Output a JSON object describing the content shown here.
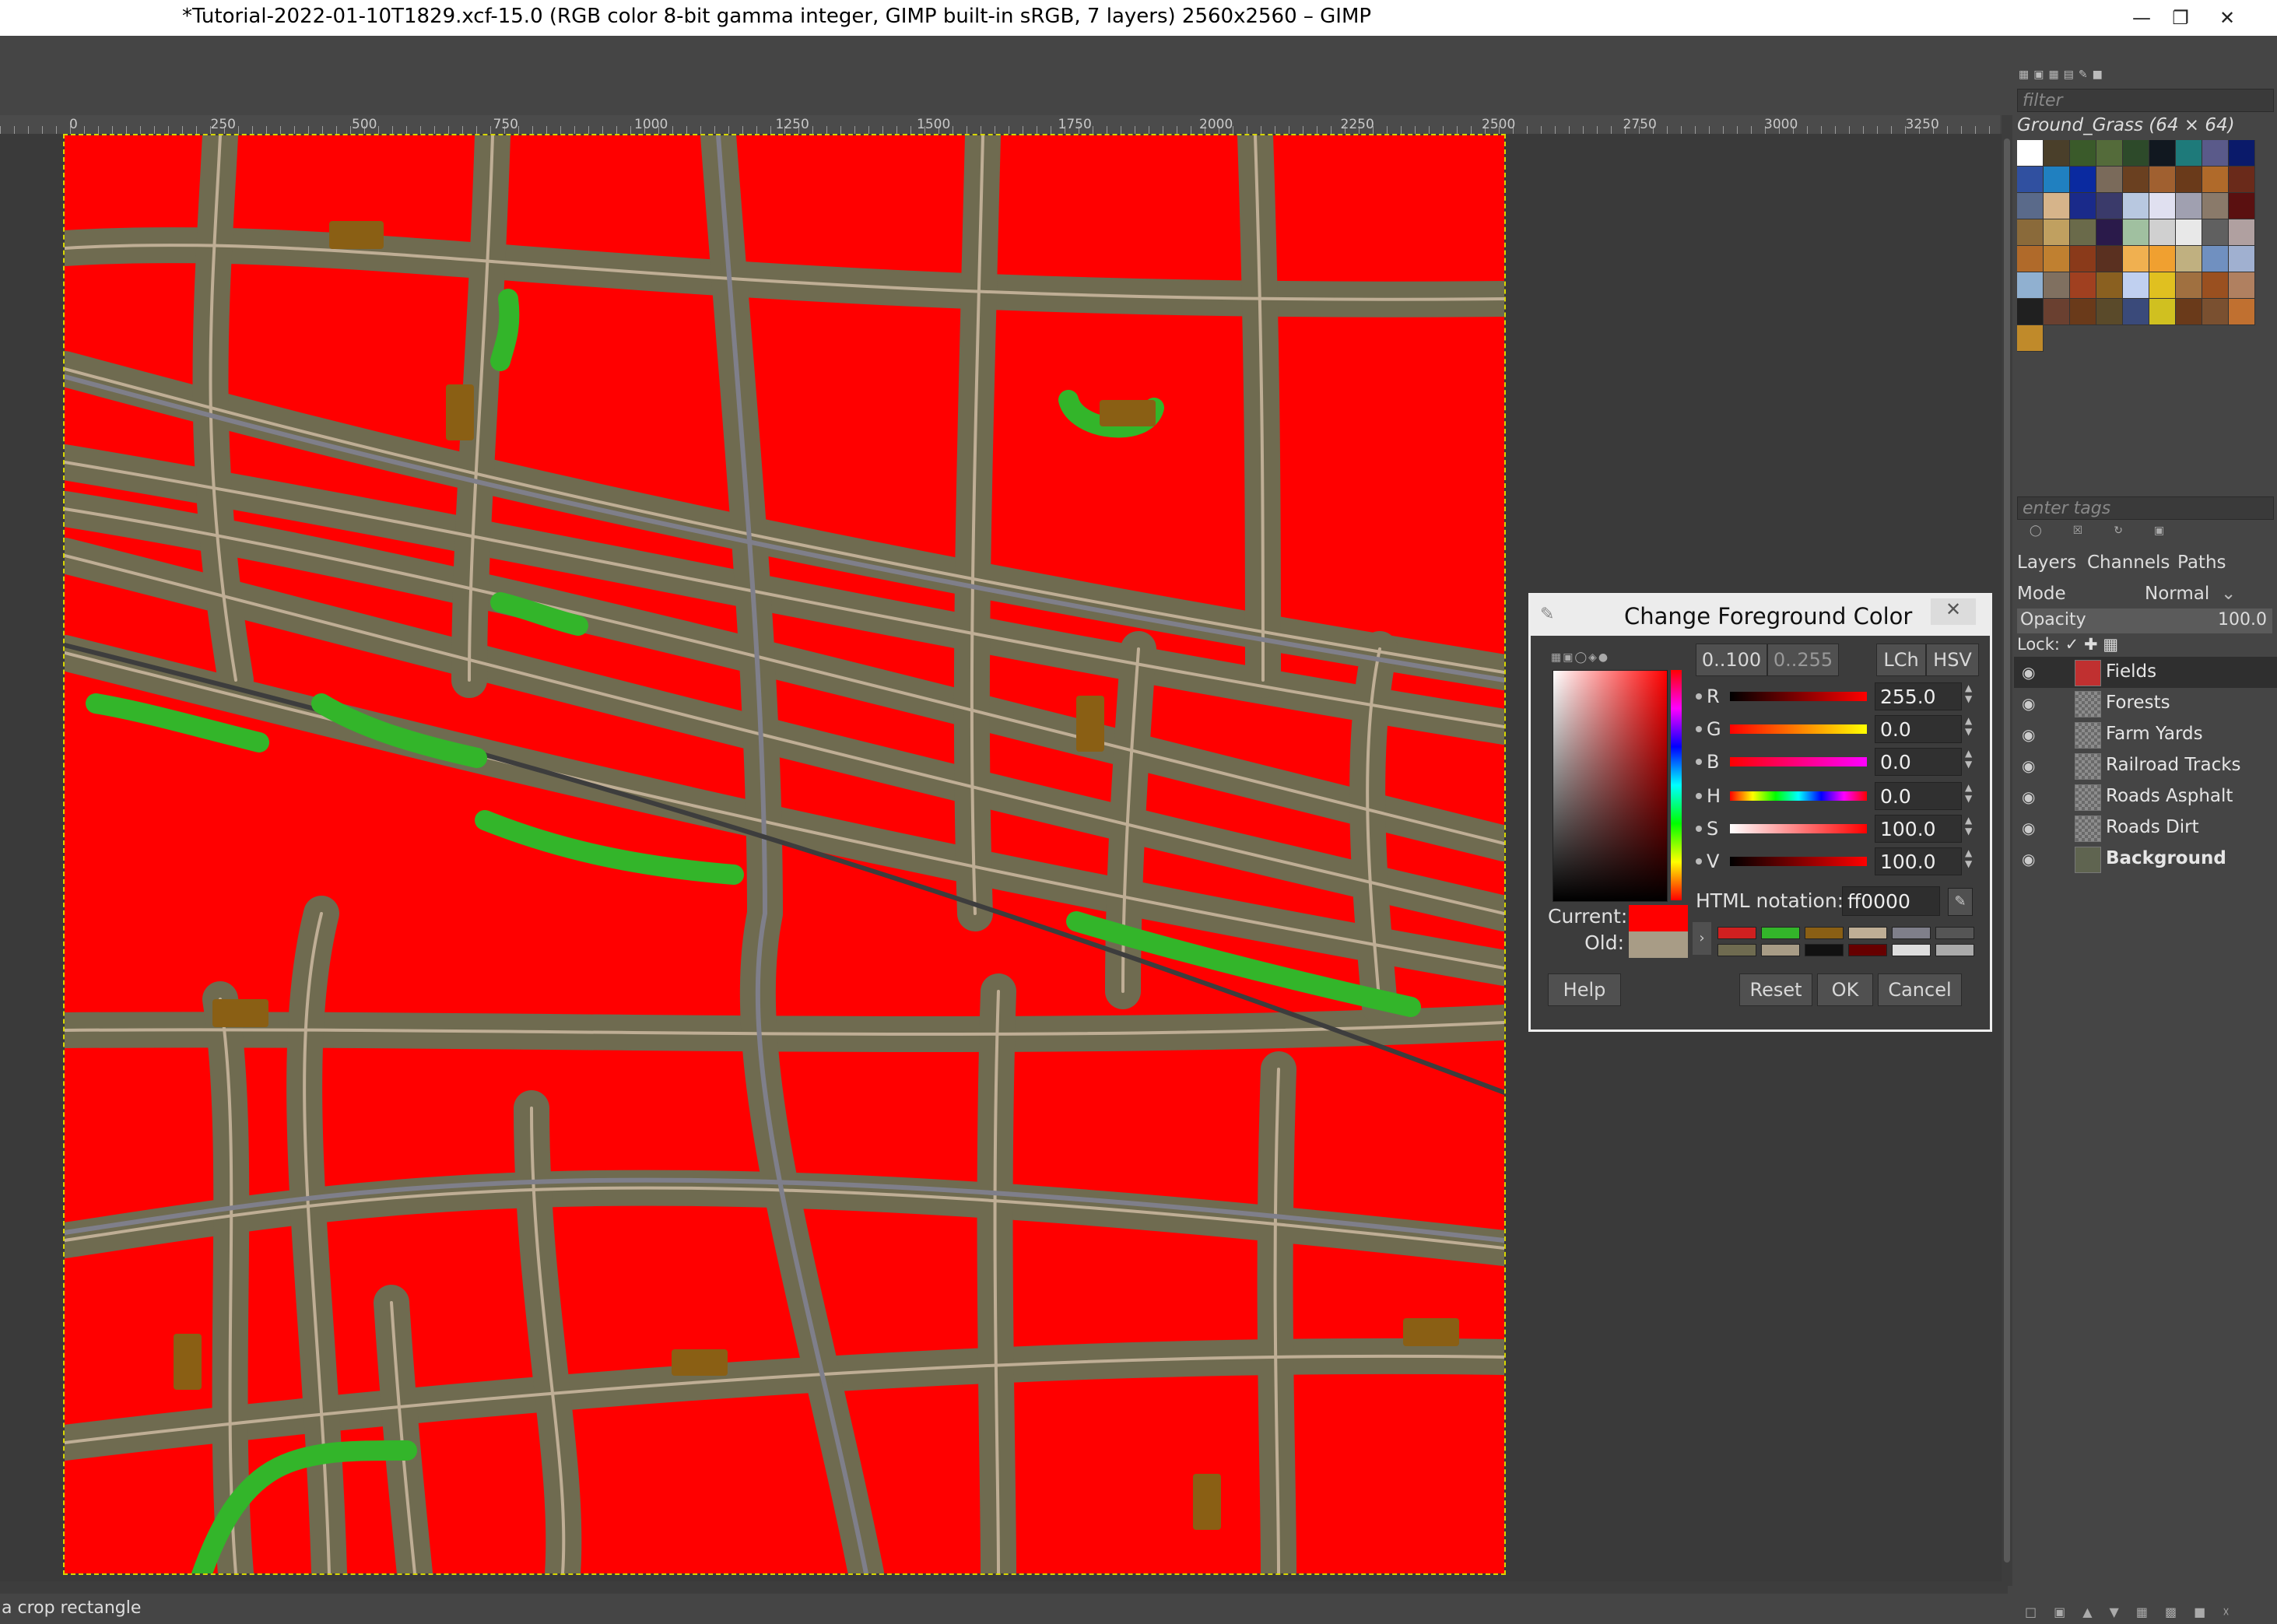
{
  "window": {
    "title": "*Tutorial-2022-01-10T1829.xcf-15.0 (RGB color 8-bit gamma integer, GIMP built-in sRGB, 7 layers) 2560x2560 – GIMP",
    "minimize_icon": "minimize-icon",
    "restore_icon": "restore-icon",
    "close_icon": "close-icon"
  },
  "ruler": {
    "ticks": [
      "0",
      "250",
      "500",
      "750",
      "1000",
      "1250",
      "1500",
      "1750",
      "2000",
      "2250",
      "2500",
      "2750",
      "3000",
      "3250"
    ]
  },
  "status": {
    "text": "a crop rectangle"
  },
  "map_colors": {
    "field": "#ff0000",
    "road_band": "#6f6b50",
    "road_dirt": "#bfae95",
    "road_asphalt": "#7f7f8a",
    "railroad": "#3d3d3d",
    "forest": "#33b52a",
    "farmyard": "#8a5f14"
  },
  "dialog": {
    "title": "Change Foreground Color",
    "range_100": "0..100",
    "range_255": "0..255",
    "lch": "LCh",
    "hsv": "HSV",
    "channels": [
      {
        "label": "R",
        "value": "255.0"
      },
      {
        "label": "G",
        "value": "0.0"
      },
      {
        "label": "B",
        "value": "0.0"
      },
      {
        "label": "H",
        "value": "0.0"
      },
      {
        "label": "S",
        "value": "100.0"
      },
      {
        "label": "V",
        "value": "100.0"
      }
    ],
    "html_notation_label": "HTML notation:",
    "html_notation_value": "ff0000",
    "current_label": "Current:",
    "old_label": "Old:",
    "current_color": "#ff0000",
    "old_color": "#a89c86",
    "history_colors": [
      "#d02020",
      "#33b52a",
      "#8a5f14",
      "#bfae95",
      "#7f7f8a",
      "#555555",
      "#6f6b50",
      "#a89c86",
      "#111111",
      "#660000",
      "#dddddd",
      "#aaaaaa"
    ],
    "buttons": {
      "help": "Help",
      "reset": "Reset",
      "ok": "OK",
      "cancel": "Cancel"
    }
  },
  "patterns": {
    "filter_placeholder": "filter",
    "selected_name": "Ground_Grass (64 × 64)",
    "tags_placeholder": "enter tags",
    "swatches": [
      "#ffffff",
      "#4a3f2a",
      "#3a5a2a",
      "#546b3a",
      "#2d4a2a",
      "#111820",
      "#1e7a7a",
      "#5a5a8a",
      "#0a1a6a",
      "#3050a0",
      "#2080c0",
      "#0a2aa0",
      "#7a6a5a",
      "#6a4020",
      "#a06030",
      "#6a3a1a",
      "#b06a2a",
      "#6a2a1a",
      "#5a6a8a",
      "#d6b48a",
      "#1a2a8a",
      "#3a3a6a",
      "#b8c8e0",
      "#e0e0f0",
      "#a0a0b0",
      "#8a7a6a",
      "#5a1010",
      "#8a6a3a",
      "#c0a060",
      "#6a6a4a",
      "#2a1a4a",
      "#a0c0a0",
      "#d0d0d0",
      "#e8e8e8",
      "#606060",
      "#b0a0a0",
      "#b06a2a",
      "#c08030",
      "#8a3a1a",
      "#5a3020",
      "#f0b050",
      "#f0a030",
      "#c0b080",
      "#7090c0",
      "#a0b0d0",
      "#90b0d0",
      "#807060",
      "#a04020",
      "#8a6020",
      "#c0d0f0",
      "#e0c020",
      "#a07040",
      "#9a5020",
      "#b08060",
      "#202020",
      "#6a4030",
      "#6a3a1a",
      "#5a4a2a",
      "#3a4a7a",
      "#d0c020",
      "#6a3a1a",
      "#7a5030",
      "#c07030",
      "#c08a2a"
    ]
  },
  "layers_panel": {
    "tabs": [
      "Layers",
      "Channels",
      "Paths"
    ],
    "mode_label": "Mode",
    "mode_value": "Normal",
    "opacity_label": "Opacity",
    "opacity_value": "100.0",
    "lock_label": "Lock:",
    "layers": [
      {
        "name": "Fields",
        "thumb": "#c03030",
        "selected": true
      },
      {
        "name": "Forests",
        "thumb": "checker",
        "selected": false
      },
      {
        "name": "Farm Yards",
        "thumb": "checker",
        "selected": false
      },
      {
        "name": "Railroad Tracks",
        "thumb": "checker",
        "selected": false
      },
      {
        "name": "Roads Asphalt",
        "thumb": "checker",
        "selected": false
      },
      {
        "name": "Roads Dirt",
        "thumb": "checker",
        "selected": false
      },
      {
        "name": "Background",
        "thumb": "#5f6450",
        "selected": false
      }
    ]
  }
}
